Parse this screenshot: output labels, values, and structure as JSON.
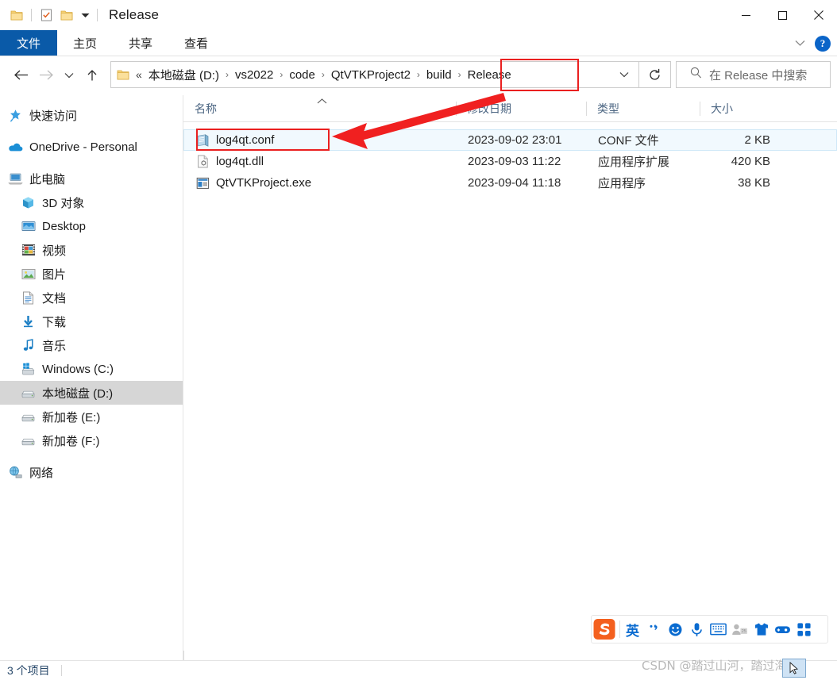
{
  "window": {
    "title": "Release",
    "quick_access": [
      "folder-icon",
      "properties-icon",
      "new-folder-icon",
      "customize-caret-icon"
    ],
    "controls": {
      "minimize": "minimize-icon",
      "maximize": "maximize-icon",
      "close": "close-icon"
    }
  },
  "ribbon": {
    "file_tab": "文件",
    "tabs": [
      "主页",
      "共享",
      "查看"
    ],
    "collapse": "chevron-down-icon",
    "help": "?"
  },
  "address": {
    "back": "back-arrow-icon",
    "forward": "forward-arrow-icon",
    "recent": "chevron-down-icon",
    "up": "up-arrow-icon",
    "prefix": "«",
    "crumbs": [
      "本地磁盘 (D:)",
      "vs2022",
      "code",
      "QtVTKProject2",
      "build",
      "Release"
    ],
    "separator": "›",
    "dropdown": "chevron-down-icon",
    "refresh": "refresh-icon",
    "highlight_crumb": "Release",
    "highlight_color": "#ea2020"
  },
  "search": {
    "icon": "search-icon",
    "placeholder": "在 Release 中搜索"
  },
  "sidebar": {
    "items": [
      {
        "label": "快速访问",
        "icon": "star-pin-icon",
        "indent": 0,
        "selected": false,
        "gap_before": false
      },
      {
        "label": "OneDrive - Personal",
        "icon": "onedrive-cloud-icon",
        "indent": 0,
        "selected": false,
        "gap_before": true
      },
      {
        "label": "此电脑",
        "icon": "this-pc-icon",
        "indent": 0,
        "selected": false,
        "gap_before": true
      },
      {
        "label": "3D 对象",
        "icon": "3d-objects-icon",
        "indent": 1,
        "selected": false,
        "gap_before": false
      },
      {
        "label": "Desktop",
        "icon": "desktop-icon",
        "indent": 1,
        "selected": false,
        "gap_before": false
      },
      {
        "label": "视频",
        "icon": "videos-icon",
        "indent": 1,
        "selected": false,
        "gap_before": false
      },
      {
        "label": "图片",
        "icon": "pictures-icon",
        "indent": 1,
        "selected": false,
        "gap_before": false
      },
      {
        "label": "文档",
        "icon": "documents-icon",
        "indent": 1,
        "selected": false,
        "gap_before": false
      },
      {
        "label": "下载",
        "icon": "downloads-icon",
        "indent": 1,
        "selected": false,
        "gap_before": false
      },
      {
        "label": "音乐",
        "icon": "music-icon",
        "indent": 1,
        "selected": false,
        "gap_before": false
      },
      {
        "label": "Windows (C:)",
        "icon": "windows-drive-icon",
        "indent": 1,
        "selected": false,
        "gap_before": false
      },
      {
        "label": "本地磁盘 (D:)",
        "icon": "drive-icon",
        "indent": 1,
        "selected": true,
        "gap_before": false
      },
      {
        "label": "新加卷 (E:)",
        "icon": "drive-icon",
        "indent": 1,
        "selected": false,
        "gap_before": false
      },
      {
        "label": "新加卷 (F:)",
        "icon": "drive-icon",
        "indent": 1,
        "selected": false,
        "gap_before": false
      },
      {
        "label": "网络",
        "icon": "network-icon",
        "indent": 0,
        "selected": false,
        "gap_before": true
      }
    ]
  },
  "filelist": {
    "columns": [
      "名称",
      "修改日期",
      "类型",
      "大小"
    ],
    "sort_column": "名称",
    "sort_direction": "ascending",
    "rows": [
      {
        "name": "log4qt.conf",
        "date": "2023-09-02 23:01",
        "type": "CONF 文件",
        "size": "2 KB",
        "icon": "conf-file-icon",
        "selected": true
      },
      {
        "name": "log4qt.dll",
        "date": "2023-09-03 11:22",
        "type": "应用程序扩展",
        "size": "420 KB",
        "icon": "dll-file-icon",
        "selected": false
      },
      {
        "name": "QtVTKProject.exe",
        "date": "2023-09-04 11:18",
        "type": "应用程序",
        "size": "38 KB",
        "icon": "exe-file-icon",
        "selected": false
      }
    ],
    "highlight_file": "log4qt.conf",
    "highlight_color": "#ea2020",
    "annotation_arrow": "red-arrow-pointing-to-log4qt-conf"
  },
  "statusbar": {
    "item_count": "3 个项目"
  },
  "ime": {
    "name": "sogou-input-method",
    "logo": "sogou-s-logo-icon",
    "mode": "英",
    "punctuation": "，",
    "buttons": [
      "emoji-icon",
      "microphone-icon",
      "soft-keyboard-icon",
      "user-badge-icon",
      "skin-shirt-icon",
      "gamepad-icon",
      "apps-grid-icon"
    ]
  },
  "watermark": {
    "text": "CSDN @踏过山河，踏过海"
  }
}
